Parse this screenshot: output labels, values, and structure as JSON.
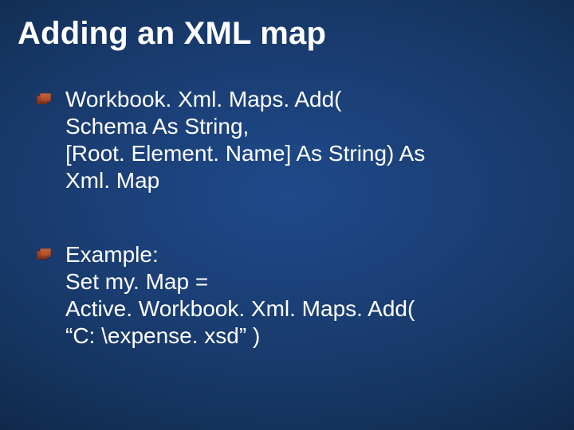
{
  "slide": {
    "title": "Adding an XML map",
    "bullets": [
      "Workbook. Xml. Maps. Add(\nSchema As String,\n[Root. Element. Name] As String) As\nXml. Map",
      "Example:\nSet my. Map =\nActive. Workbook. Xml. Maps. Add(\n“C: \\expense. xsd” )"
    ]
  }
}
